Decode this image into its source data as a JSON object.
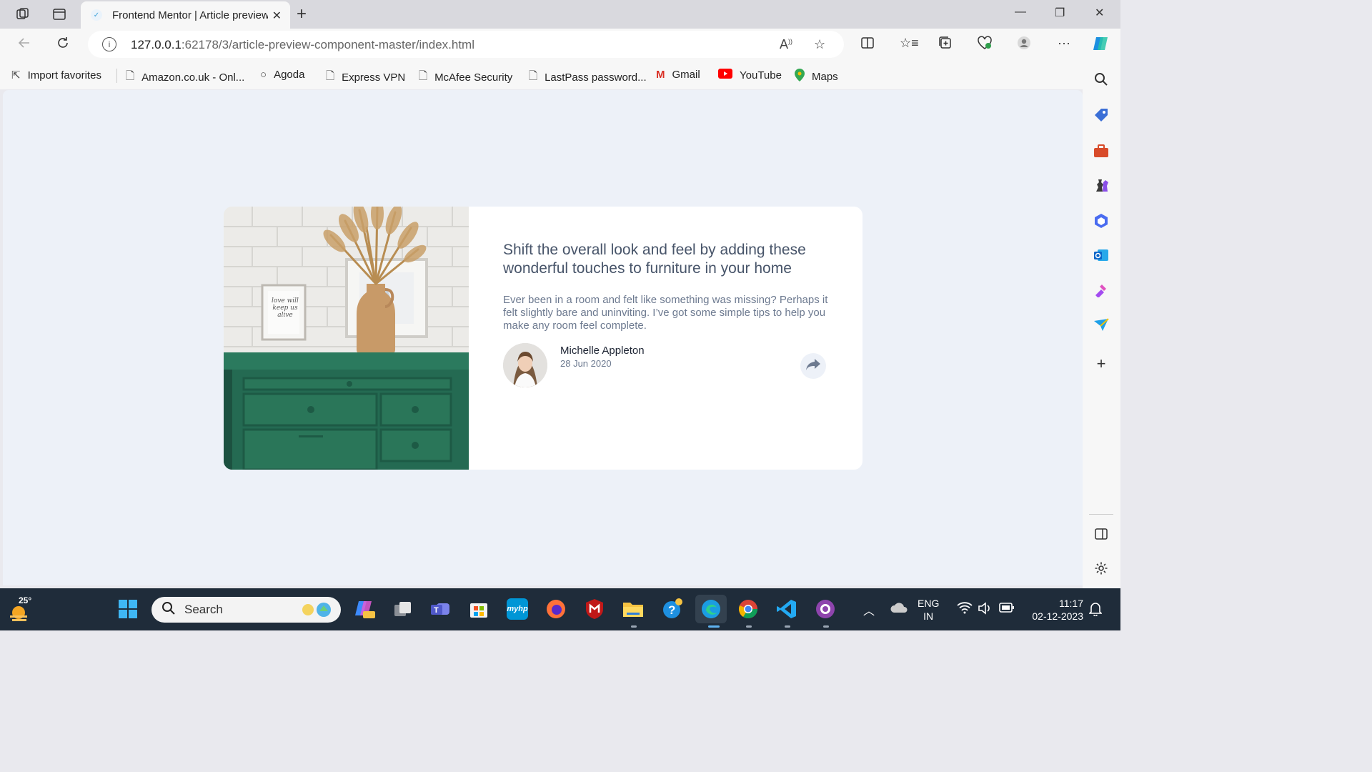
{
  "browser": {
    "tab_title": "Frontend Mentor | Article preview",
    "url_host": "127.0.0.1",
    "url_rest": ":62178/3/article-preview-component-master/index.html"
  },
  "favorites": [
    {
      "label": "Import favorites",
      "icon": "import-icon"
    },
    {
      "label": "Amazon.co.uk - Onl...",
      "icon": "page-icon"
    },
    {
      "label": "Agoda",
      "icon": "agoda-icon"
    },
    {
      "label": "Express VPN",
      "icon": "page-icon"
    },
    {
      "label": "McAfee Security",
      "icon": "page-icon"
    },
    {
      "label": "LastPass password...",
      "icon": "page-icon"
    },
    {
      "label": "Gmail",
      "icon": "gmail-icon"
    },
    {
      "label": "YouTube",
      "icon": "youtube-icon"
    },
    {
      "label": "Maps",
      "icon": "maps-icon"
    }
  ],
  "article": {
    "headline": "Shift the overall look and feel by adding these wonderful touches to furniture in your home",
    "description": "Ever been in a room and felt like something was missing? Perhaps it felt slightly bare and uninviting. I’ve got some simple tips to help you make any room feel complete.",
    "author_name": "Michelle Appleton",
    "date": "28 Jun 2020",
    "frame_text": "love will keep us alive"
  },
  "taskbar": {
    "temperature": "25°",
    "search_placeholder": "Search",
    "lang_line1": "ENG",
    "lang_line2": "IN",
    "time": "11:17",
    "date": "02-12-2023"
  },
  "colors": {
    "page_bg": "#edf1f8",
    "headline": "#48556a",
    "body_text": "#6d7a90",
    "taskbar": "#1f2c3a"
  }
}
